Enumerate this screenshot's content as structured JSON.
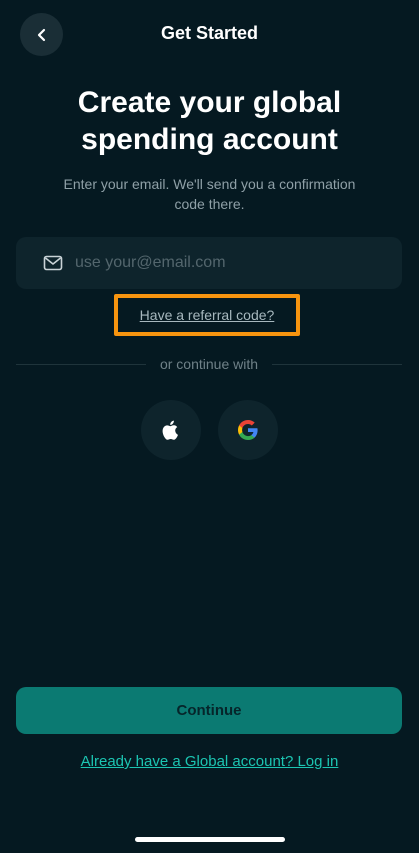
{
  "header": {
    "title": "Get Started",
    "back_icon": "chevron-left-icon"
  },
  "main": {
    "headline": "Create your global spending account",
    "subtitle": "Enter your email. We'll send you a confirmation code there.",
    "email": {
      "value": "",
      "placeholder": "use your@email.com",
      "icon": "mail-icon"
    },
    "referral_link": "Have a referral code?",
    "divider_text": "or continue with",
    "social": [
      {
        "name": "apple",
        "icon": "apple-icon"
      },
      {
        "name": "google",
        "icon": "google-icon"
      }
    ]
  },
  "footer": {
    "continue_label": "Continue",
    "login_link": "Already have a Global account? Log in"
  },
  "colors": {
    "background": "#051921",
    "accent": "#0b7a72",
    "link": "#1cc5b2",
    "highlight": "#f7940f"
  }
}
